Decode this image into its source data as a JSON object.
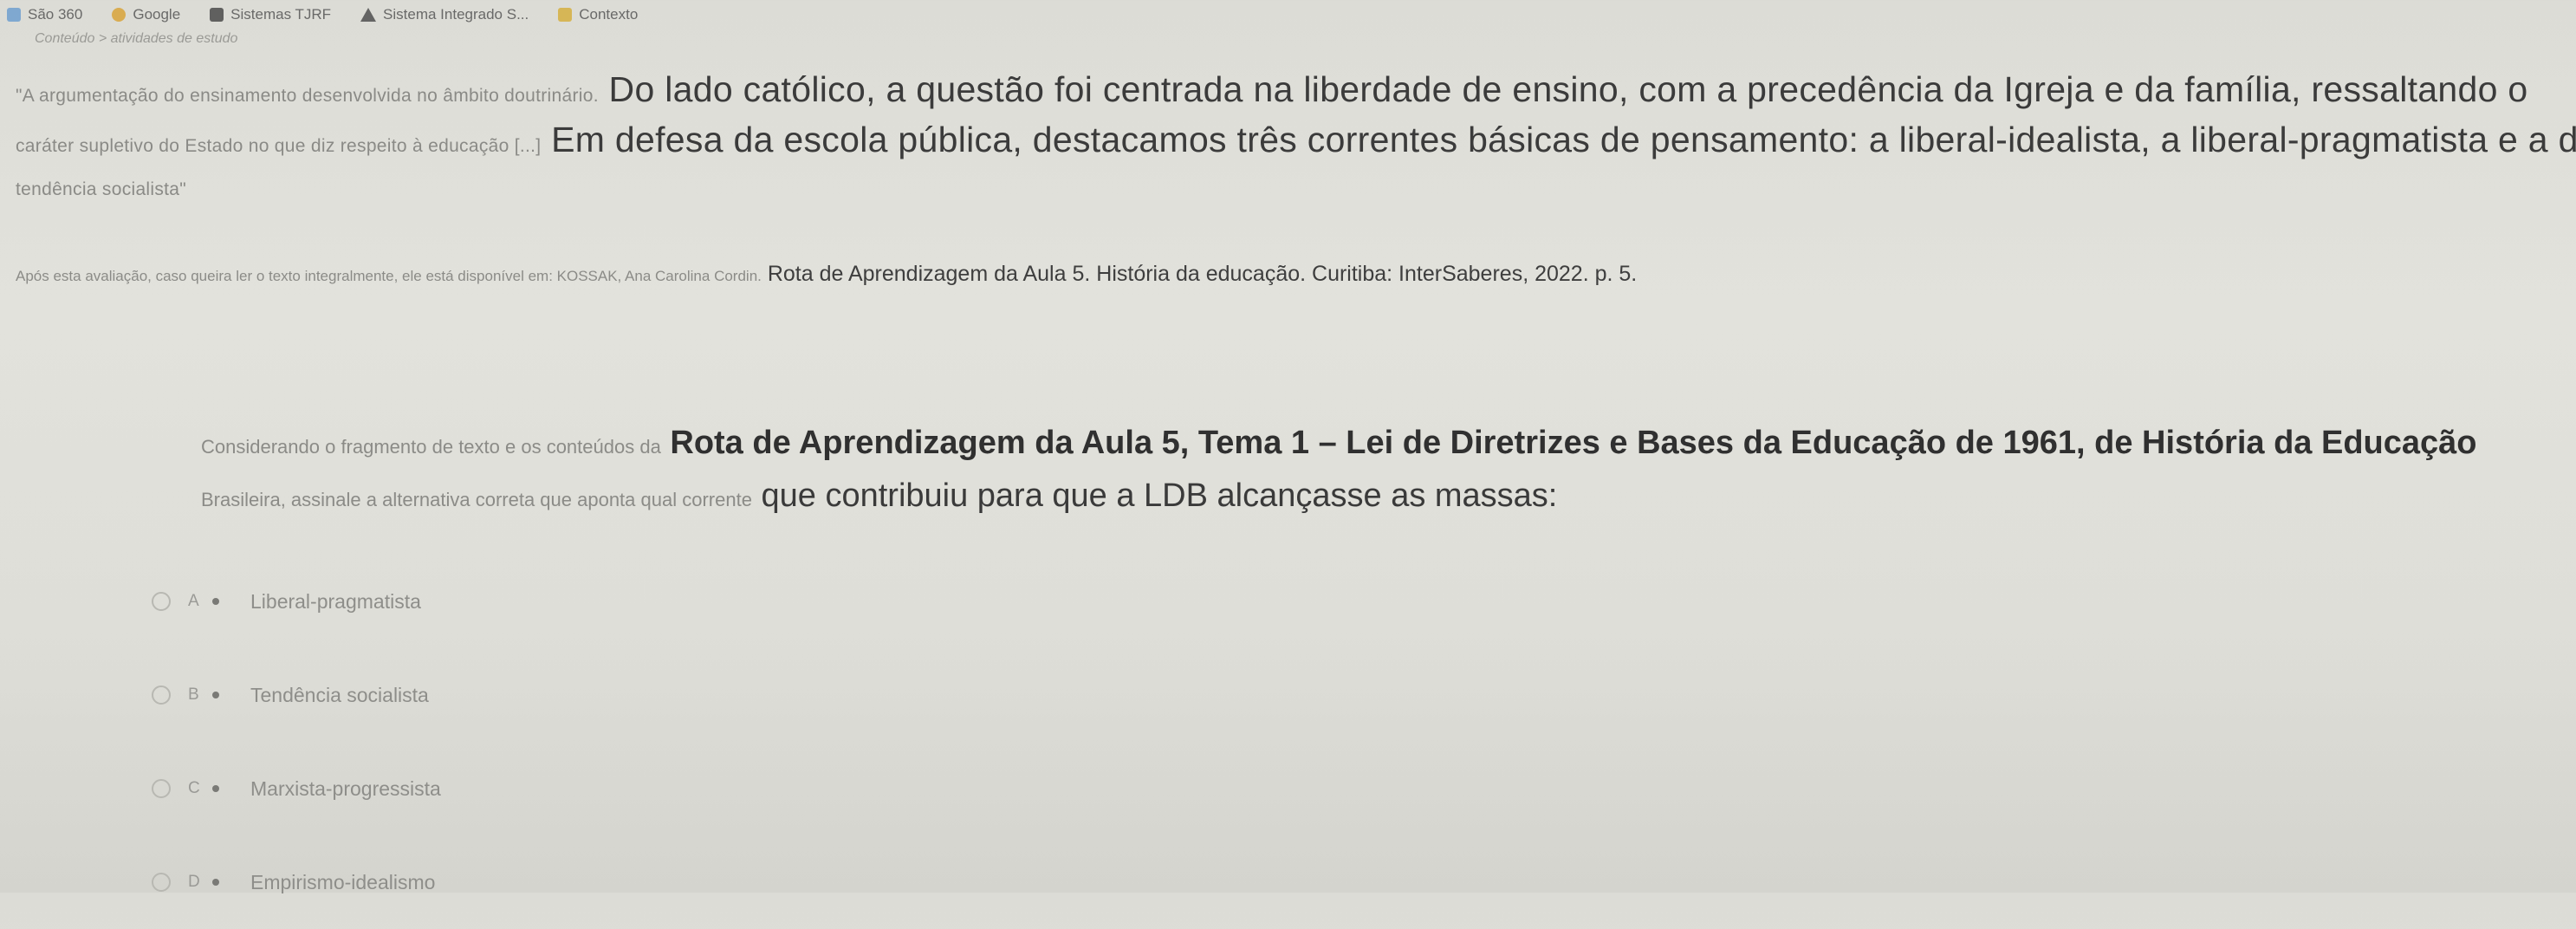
{
  "bookmarks": [
    {
      "label": "São 360",
      "icon": "site-icon",
      "color": "#4a90d9"
    },
    {
      "label": "Google",
      "icon": "google-icon",
      "color": "#e0a030"
    },
    {
      "label": "Sistemas TJRF",
      "icon": "bookmark-icon",
      "color": "#404040"
    },
    {
      "label": "Sistema Integrado S...",
      "icon": "warning-icon",
      "color": "#505050"
    },
    {
      "label": "Contexto",
      "icon": "folder-icon",
      "color": "#d6b040"
    }
  ],
  "subheader": "Conteúdo > atividades de estudo",
  "quote": {
    "line1_prefix": "\"A argumentação do ensinamento desenvolvida no âmbito doutrinário.",
    "line1_main": "Do lado católico, a questão foi centrada na liberdade de ensino, com a precedência da Igreja e da família, ressaltando o",
    "line2_prefix": "caráter supletivo do Estado no que diz respeito à educação [...]",
    "line2_main": "Em defesa da escola pública, destacamos três correntes básicas de pensamento: a liberal-idealista, a liberal-pragmatista e a de",
    "line3": "tendência socialista\""
  },
  "source": {
    "prefix": "Após esta avaliação, caso queira ler o texto integralmente, ele está disponível em: KOSSAK, Ana Carolina Cordin.",
    "main": "Rota de Aprendizagem da Aula 5. História da educação. Curitiba: InterSaberes, 2022. p. 5."
  },
  "question": {
    "line1_prefix": "Considerando o fragmento de texto e os conteúdos da",
    "line1_main": "Rota de Aprendizagem da Aula 5, Tema 1 – Lei de Diretrizes e Bases da Educação de 1961, de História da Educação",
    "line2_prefix": "Brasileira, assinale a alternativa correta que aponta qual corrente",
    "line2_main": "que contribuiu para que a LDB alcançasse as massas:"
  },
  "options": [
    {
      "letter": "A",
      "text": "Liberal-pragmatista"
    },
    {
      "letter": "B",
      "text": "Tendência socialista"
    },
    {
      "letter": "C",
      "text": "Marxista-progressista"
    },
    {
      "letter": "D",
      "text": "Empirismo-idealismo"
    }
  ]
}
